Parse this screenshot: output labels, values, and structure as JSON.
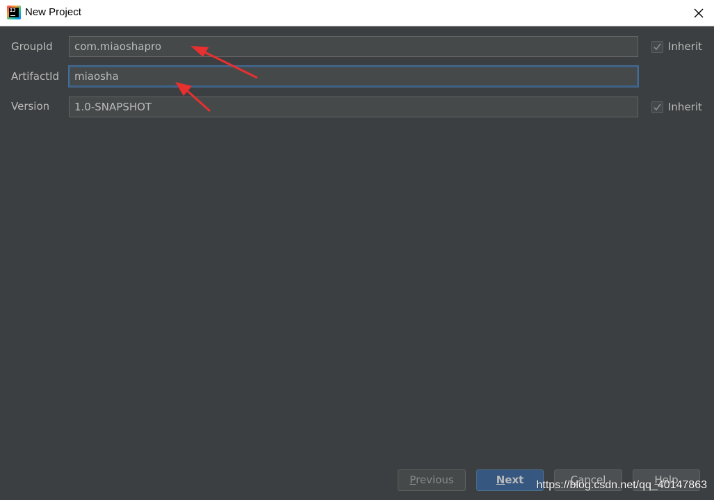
{
  "window": {
    "title": "New Project",
    "app_icon": "intellij-idea-icon",
    "close_icon": "close-icon"
  },
  "form": {
    "group_id": {
      "label": "GroupId",
      "value": "com.miaoshapro",
      "inherit_label": "Inherit",
      "inherit_checked": true
    },
    "artifact_id": {
      "label": "ArtifactId",
      "value": "miaosha"
    },
    "version": {
      "label": "Version",
      "value": "1.0-SNAPSHOT",
      "inherit_label": "Inherit",
      "inherit_checked": true
    }
  },
  "buttons": {
    "previous": {
      "mnemonic": "P",
      "rest": "revious"
    },
    "next": {
      "mnemonic": "N",
      "rest": "ext"
    },
    "cancel": {
      "mnemonic": "C",
      "rest": "ancel"
    },
    "help": {
      "mnemonic": "H",
      "rest": "elp"
    }
  },
  "watermark": "https://blog.csdn.net/qq_40147863",
  "colors": {
    "background": "#3c3f41",
    "field_bg": "#45494a",
    "focus_border": "#3d6185",
    "default_button": "#365880",
    "annotation_arrow": "#e8302f"
  }
}
